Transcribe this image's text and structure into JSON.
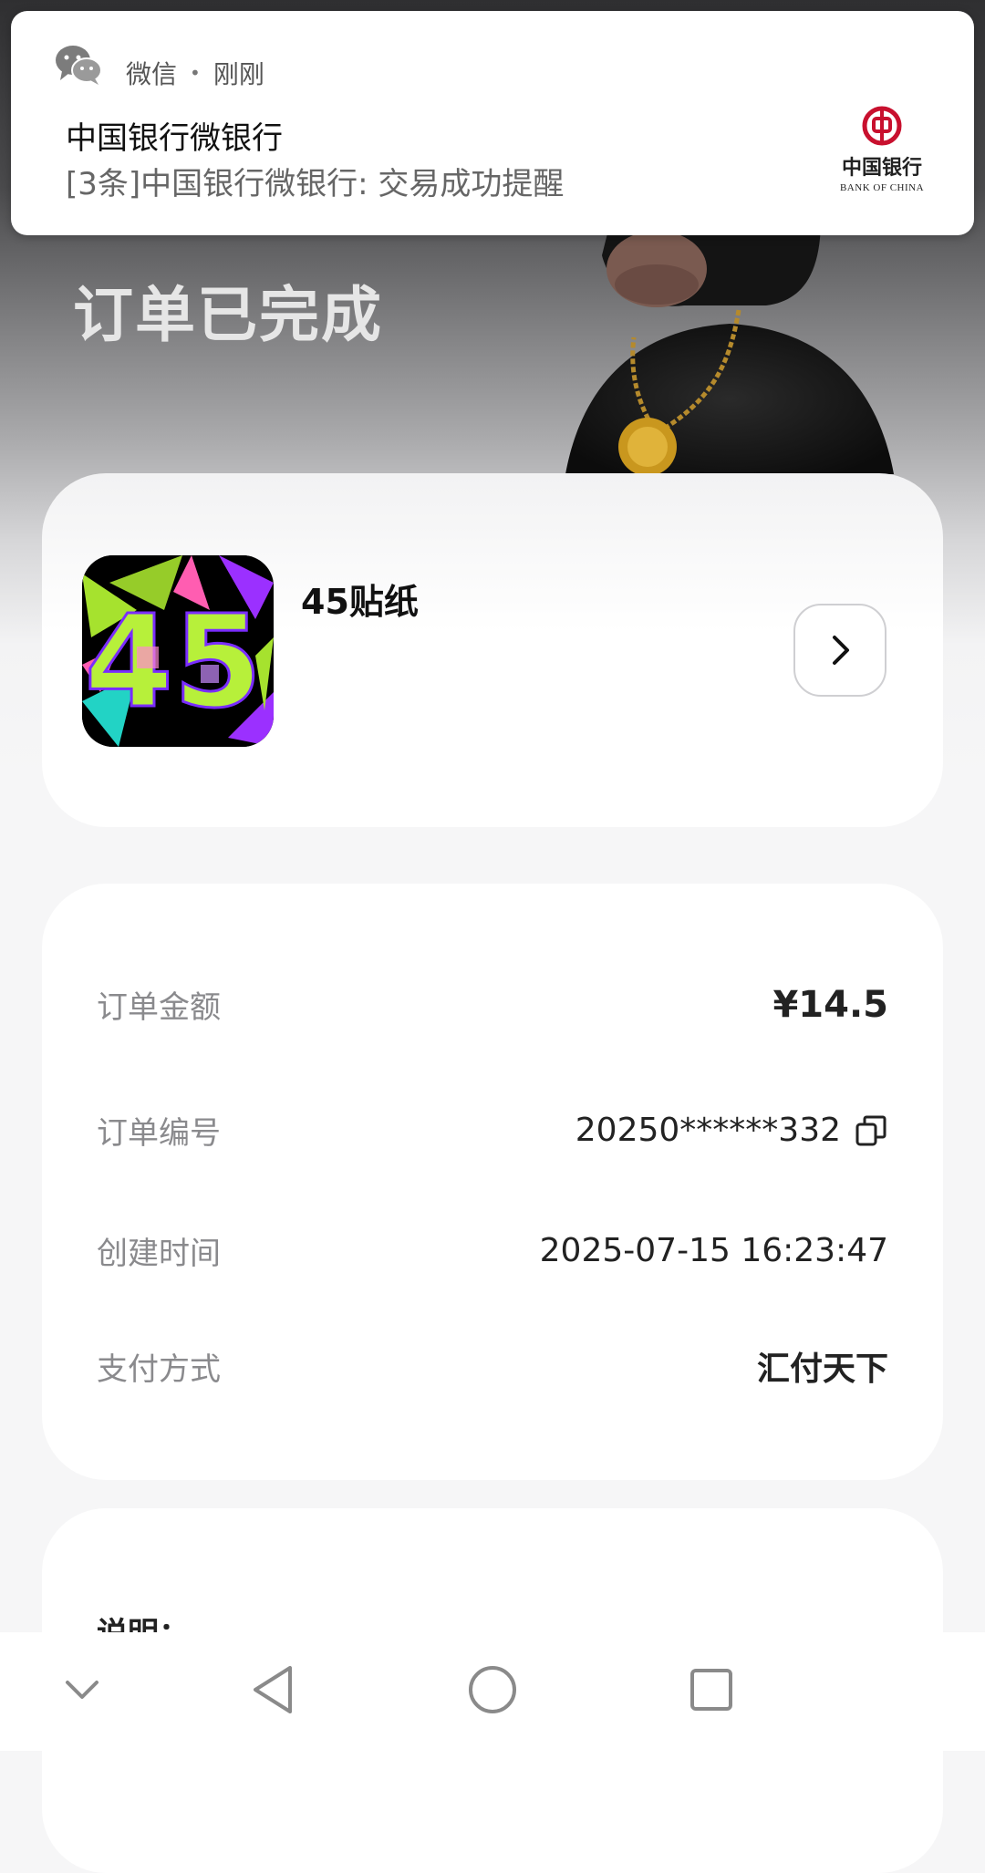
{
  "notification": {
    "app_name": "微信",
    "time": "刚刚",
    "title": "中国银行微银行",
    "body": "[3条]中国银行微银行: 交易成功提醒",
    "bank_logo_cn": "中国银行",
    "bank_logo_en": "BANK OF CHINA",
    "icon": "wechat-icon"
  },
  "header": {
    "title": "订单已完成"
  },
  "product": {
    "name": "45贴纸",
    "thumb_text": "45"
  },
  "order": {
    "rows": [
      {
        "label": "订单金额",
        "value": "¥14.5"
      },
      {
        "label": "订单编号",
        "value": "20250******332"
      },
      {
        "label": "创建时间",
        "value": "2025-07-15 16:23:47"
      },
      {
        "label": "支付方式",
        "value": "汇付天下"
      }
    ]
  },
  "note": {
    "title": "说明："
  },
  "navbar": {
    "icons": [
      "chevron-down-icon",
      "back-icon",
      "home-icon",
      "recents-icon"
    ]
  }
}
